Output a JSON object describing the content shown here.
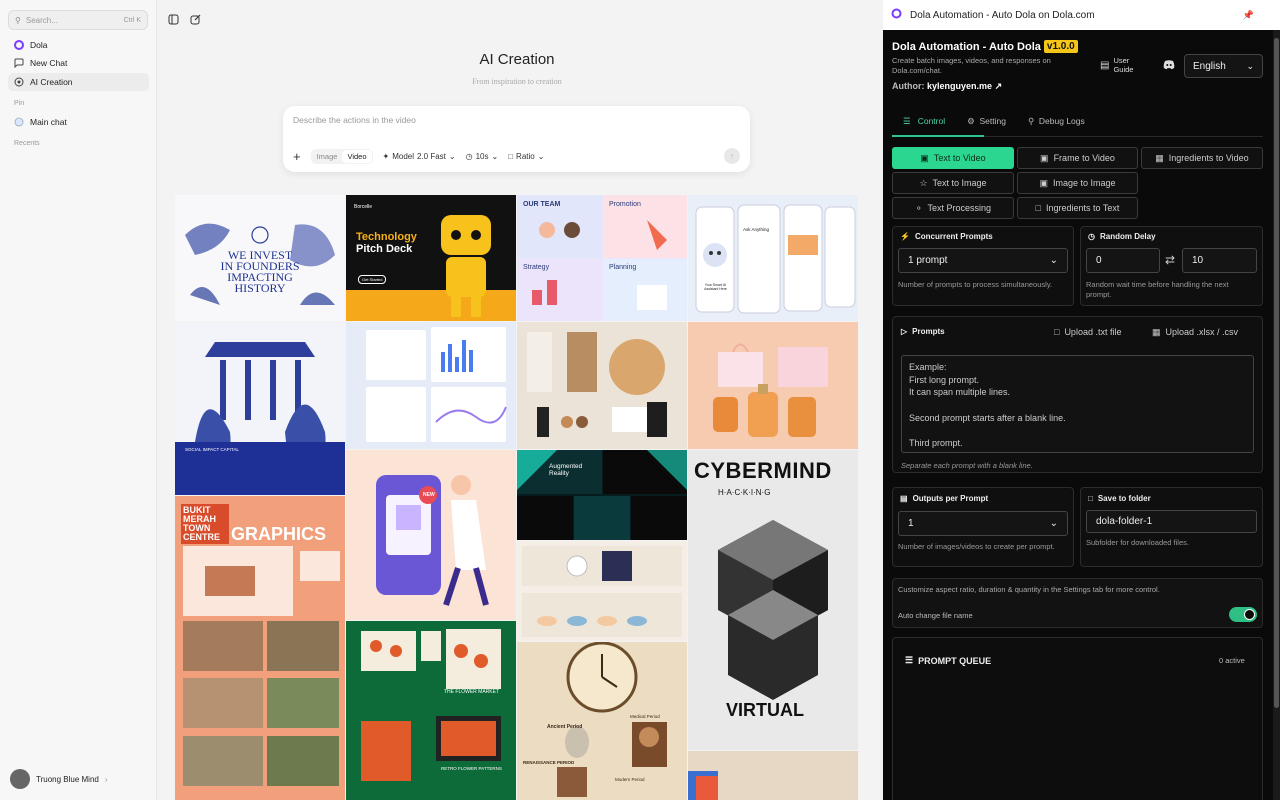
{
  "sidebar": {
    "search_placeholder": "Search...",
    "search_shortcut": "Ctrl K",
    "items": [
      {
        "label": "Dola"
      },
      {
        "label": "New Chat"
      },
      {
        "label": "AI Creation"
      }
    ],
    "pin_label": "Pin",
    "pinned": [
      {
        "label": "Main chat"
      }
    ],
    "recents_label": "Recents",
    "user_name": "Truong Blue Mind"
  },
  "main": {
    "title": "AI Creation",
    "subtitle": "From inspiration to creation",
    "composer": {
      "placeholder": "Describe the actions in the video",
      "mode_image": "Image",
      "mode_video": "Video",
      "model_label": "Model",
      "model_value": "2.0 Fast",
      "duration": "10s",
      "ratio": "Ratio"
    },
    "gallery": [
      {
        "t1": "WE INVEST",
        "t2": "IN FOUNDERS",
        "t3": "IMPACTING",
        "t4": "HISTORY"
      },
      {
        "brand": "Borcelle",
        "t1": "Technology",
        "t2": "Pitch Deck",
        "t3": "Get Started"
      },
      {
        "t1": "OUR TEAM",
        "t2": "Promotion",
        "t3": "Strategy",
        "t4": "Planning"
      },
      {
        "t1": "Ask Anything",
        "t2": "Your Smart AI Assistant Here"
      },
      {
        "t1": "SOCIAL IMPACT CAPITAL"
      },
      {
        "t1": "NEW"
      },
      {
        "t1": "Augmented",
        "t2": "Reality"
      },
      {
        "t1": "CYBERMIND",
        "t2": "H·A·C·K·I·N·G",
        "t3": "VIRTUAL"
      },
      {
        "t1": "BUKIT",
        "t2": "MERAH",
        "t3": "TOWN",
        "t4": "CENTRE",
        "t5": "GRAPHICS"
      },
      {
        "t1": "THE FLOWER MARKET",
        "t2": "RETRO FLOWER PATTERNS"
      },
      {
        "t1": "Ancient Period",
        "t2": "Medical Period",
        "t3": "RENAISSANCE PERIOD",
        "t4": "Modern Period"
      }
    ]
  },
  "panel": {
    "window_title": "Dola Automation - Auto Dola on Dola.com",
    "title": "Dola Automation - Auto Dola",
    "version": "v1.0.0",
    "description": "Create batch images, videos, and responses on Dola.com/chat.",
    "author_label": "Author:",
    "author_name": "kylenguyen.me",
    "user_guide": "User Guide",
    "language": "English",
    "tabs": [
      "Control",
      "Setting",
      "Debug Logs"
    ],
    "modes": [
      "Text to Video",
      "Frame to Video",
      "Ingredients to Video",
      "Text to Image",
      "Image to Image",
      "Text Processing",
      "Ingredients to Text"
    ],
    "concurrent": {
      "label": "Concurrent Prompts",
      "value": "1 prompt",
      "help": "Number of prompts to process simultaneously."
    },
    "delay": {
      "label": "Random Delay",
      "min": "0",
      "max": "10",
      "help": "Random wait time before handling the next prompt."
    },
    "prompts": {
      "label": "Prompts",
      "upload_txt": "Upload .txt file",
      "upload_xlsx": "Upload .xlsx / .csv",
      "placeholder": "Example:\nFirst long prompt.\nIt can span multiple lines.\n\nSecond prompt starts after a blank line.\n\nThird prompt.",
      "help": "Separate each prompt with a blank line."
    },
    "outputs": {
      "label": "Outputs per Prompt",
      "value": "1",
      "help": "Number of images/videos to create per prompt."
    },
    "folder": {
      "label": "Save to folder",
      "value": "dola-folder-1",
      "help": "Subfolder for downloaded files."
    },
    "settings_hint": "Customize aspect ratio, duration & quantity in the Settings tab for more control.",
    "auto_rename_label": "Auto change file name",
    "auto_rename": true,
    "queue_title": "PROMPT QUEUE",
    "queue_count": "0 active",
    "accent": "#2bd690",
    "version_color": "#f5c518"
  }
}
